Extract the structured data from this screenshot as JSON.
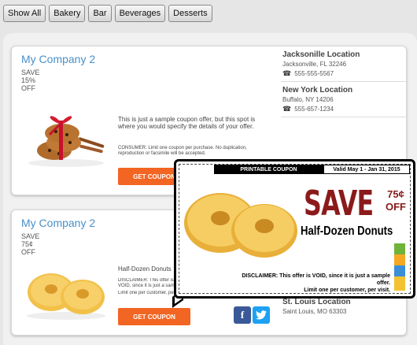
{
  "filters": [
    "Show All",
    "Bakery",
    "Bar",
    "Beverages",
    "Desserts"
  ],
  "coupons": [
    {
      "company": "My Company 2",
      "save_label": "SAVE",
      "save_amount": "15%",
      "save_unit": "OFF",
      "description": "This is just a sample coupon offer, but this spot is where you would specify the details of your offer.",
      "fine_print": "CONSUMER: Limit one coupon per purchase. No duplication, reproduction or facsimile will be accepted.",
      "cta": "GET COUPON"
    },
    {
      "company": "My Company 2",
      "save_label": "SAVE",
      "save_amount": "75¢",
      "save_unit": "OFF",
      "description": "Half-Dozen Donuts",
      "fine_print": "DISCLAIMER: This offer is VOID, since it is just a sample offer.",
      "fine_print2": "Limit one per customer, per visit.",
      "cta": "GET COUPON"
    }
  ],
  "locations_card1": [
    {
      "name": "Jacksonille Location",
      "address": "Jacksonville, FL 32246",
      "phone": "555-555-5567"
    },
    {
      "name": "New York Location",
      "address": "Buffalo, NY 14206",
      "phone": "555-657-1234"
    }
  ],
  "locations_card2": [
    {
      "name": "St. Louis Location",
      "address": "Saint Louis, MO 63303"
    }
  ],
  "popup": {
    "printable": "PRINTABLE COUPON",
    "valid": "Valid May 1 - Jan 31, 2015",
    "save": "SAVE",
    "price": "75¢",
    "off": "OFF",
    "item": "Half-Dozen Donuts",
    "disclaimer": "DISCLAIMER: This offer is VOID, since it is just a sample offer.",
    "limit": "Limit one per customer, per visit."
  },
  "icons": {
    "phone": "phone-icon",
    "facebook": "facebook-icon",
    "twitter": "twitter-icon"
  },
  "colors": {
    "accent_orange": "#f26522",
    "company_blue": "#4a90c8",
    "save_red": "#8b1a1a"
  }
}
